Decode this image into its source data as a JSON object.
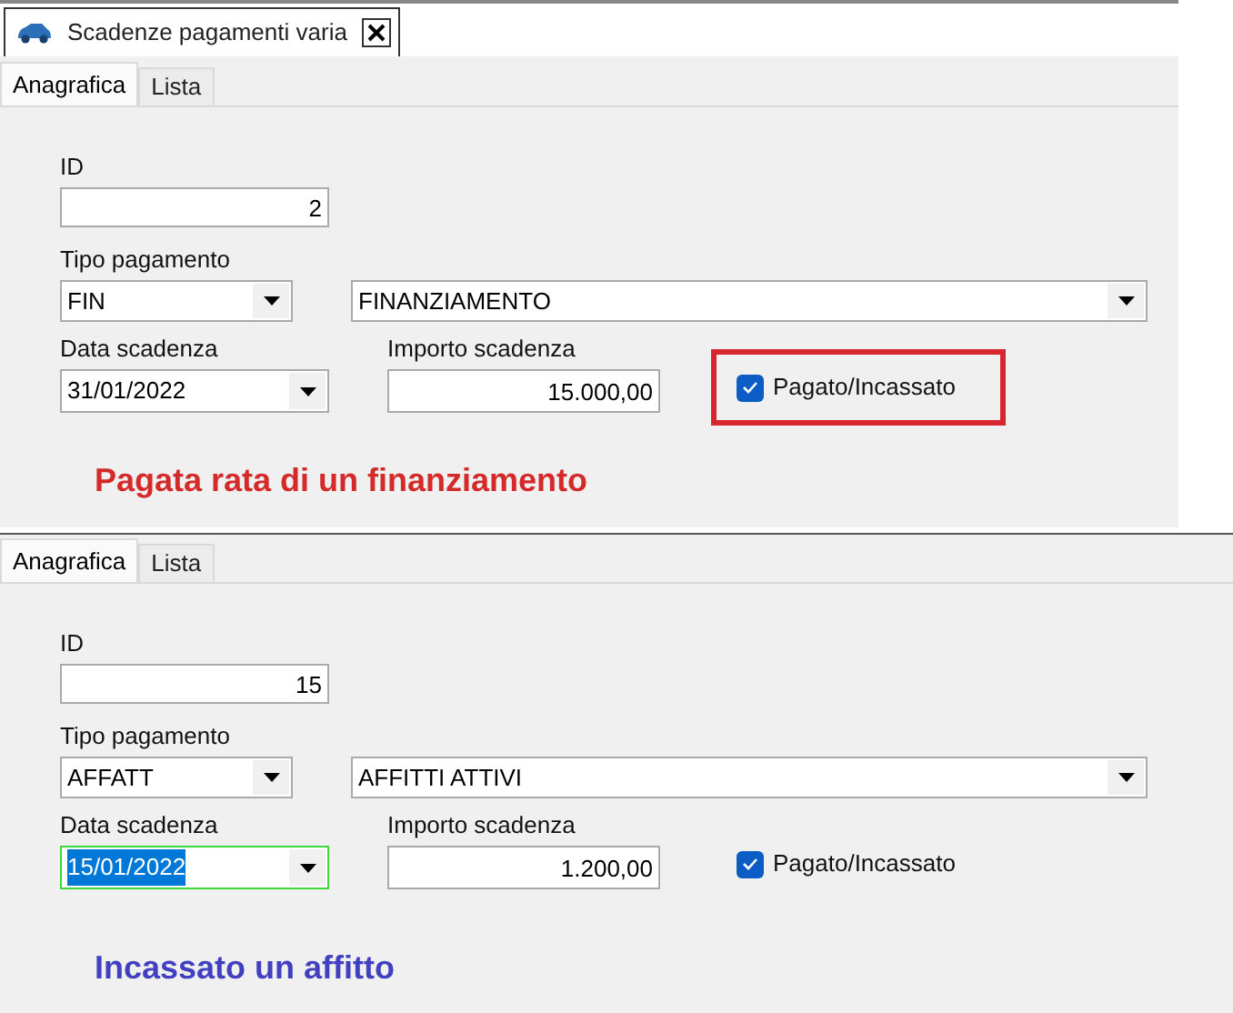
{
  "panels": [
    {
      "window_tab": {
        "title": "Scadenze pagamenti varia"
      },
      "tabs": [
        {
          "label": "Anagrafica",
          "selected": true
        },
        {
          "label": "Lista",
          "selected": false
        }
      ],
      "id": {
        "label": "ID",
        "value": "2"
      },
      "tipo_pagamento": {
        "label": "Tipo pagamento",
        "code": "FIN",
        "description": "FINANZIAMENTO"
      },
      "data_scadenza": {
        "label": "Data scadenza",
        "value": "31/01/2022",
        "focused": false
      },
      "importo_scadenza": {
        "label": "Importo scadenza",
        "value": "15.000,00"
      },
      "pagato": {
        "label": "Pagato/Incassato",
        "checked": true,
        "highlighted": true
      },
      "annotation": {
        "text": "Pagata rata di un finanziamento",
        "color": "#d42a2a"
      }
    },
    {
      "tabs": [
        {
          "label": "Anagrafica",
          "selected": true
        },
        {
          "label": "Lista",
          "selected": false
        }
      ],
      "id": {
        "label": "ID",
        "value": "15"
      },
      "tipo_pagamento": {
        "label": "Tipo pagamento",
        "code": "AFFATT",
        "description": "AFFITTI ATTIVI"
      },
      "data_scadenza": {
        "label": "Data scadenza",
        "value": "15/01/2022",
        "focused": true
      },
      "importo_scadenza": {
        "label": "Importo scadenza",
        "value": "1.200,00"
      },
      "pagato": {
        "label": "Pagato/Incassato",
        "checked": true,
        "highlighted": false
      },
      "annotation": {
        "text": "Incassato un affitto",
        "color": "#4040c0"
      }
    }
  ]
}
